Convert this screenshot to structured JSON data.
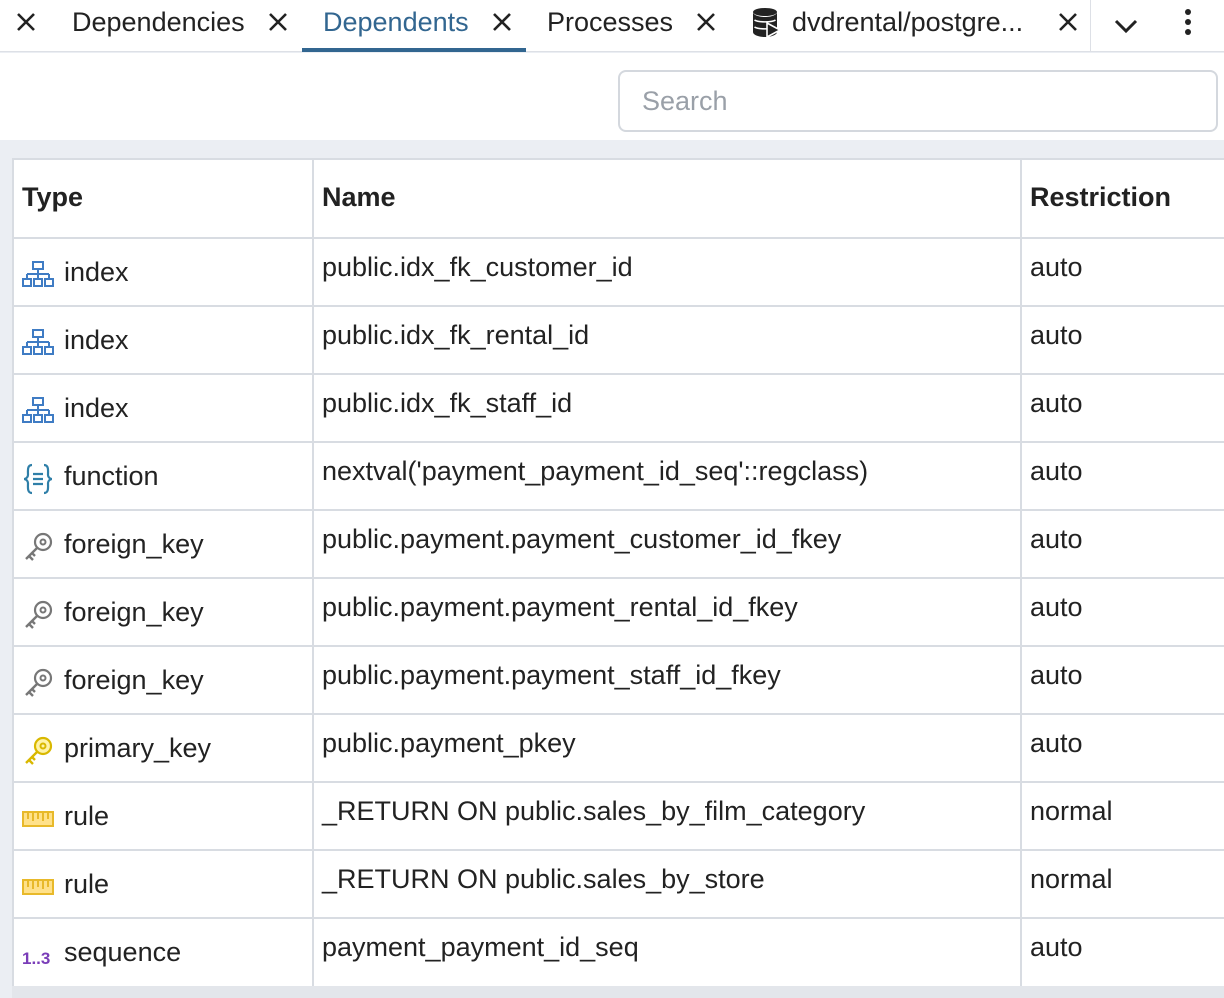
{
  "tabs": [
    {
      "label": "Dependencies"
    },
    {
      "label": "Dependents",
      "active": true
    },
    {
      "label": "Processes"
    },
    {
      "label": "dvdrental/postgre..."
    }
  ],
  "search": {
    "placeholder": "Search",
    "value": ""
  },
  "table": {
    "columns": [
      "Type",
      "Name",
      "Restriction"
    ],
    "rows": [
      {
        "icon": "index-icon",
        "type": "index",
        "name": "public.idx_fk_customer_id",
        "restriction": "auto"
      },
      {
        "icon": "index-icon",
        "type": "index",
        "name": "public.idx_fk_rental_id",
        "restriction": "auto"
      },
      {
        "icon": "index-icon",
        "type": "index",
        "name": "public.idx_fk_staff_id",
        "restriction": "auto"
      },
      {
        "icon": "function-icon",
        "type": "function",
        "name": "nextval('payment_payment_id_seq'::regclass)",
        "restriction": "auto"
      },
      {
        "icon": "foreign-key-icon",
        "type": "foreign_key",
        "name": "public.payment.payment_customer_id_fkey",
        "restriction": "auto"
      },
      {
        "icon": "foreign-key-icon",
        "type": "foreign_key",
        "name": "public.payment.payment_rental_id_fkey",
        "restriction": "auto"
      },
      {
        "icon": "foreign-key-icon",
        "type": "foreign_key",
        "name": "public.payment.payment_staff_id_fkey",
        "restriction": "auto"
      },
      {
        "icon": "primary-key-icon",
        "type": "primary_key",
        "name": "public.payment_pkey",
        "restriction": "auto"
      },
      {
        "icon": "rule-icon",
        "type": "rule",
        "name": "_RETURN ON public.sales_by_film_category",
        "restriction": "normal"
      },
      {
        "icon": "rule-icon",
        "type": "rule",
        "name": "_RETURN ON public.sales_by_store",
        "restriction": "normal"
      },
      {
        "icon": "sequence-icon",
        "type": "sequence",
        "name": "payment_payment_id_seq",
        "restriction": "auto"
      }
    ]
  },
  "colors": {
    "accent": "#326690",
    "index_icon": "#3f7cc4",
    "function_icon": "#2f7fa8",
    "key_icon": "#777777",
    "primary_key_icon": "#d9b800",
    "rule_icon": "#e8b92a",
    "sequence_icon": "#7a3db8"
  }
}
